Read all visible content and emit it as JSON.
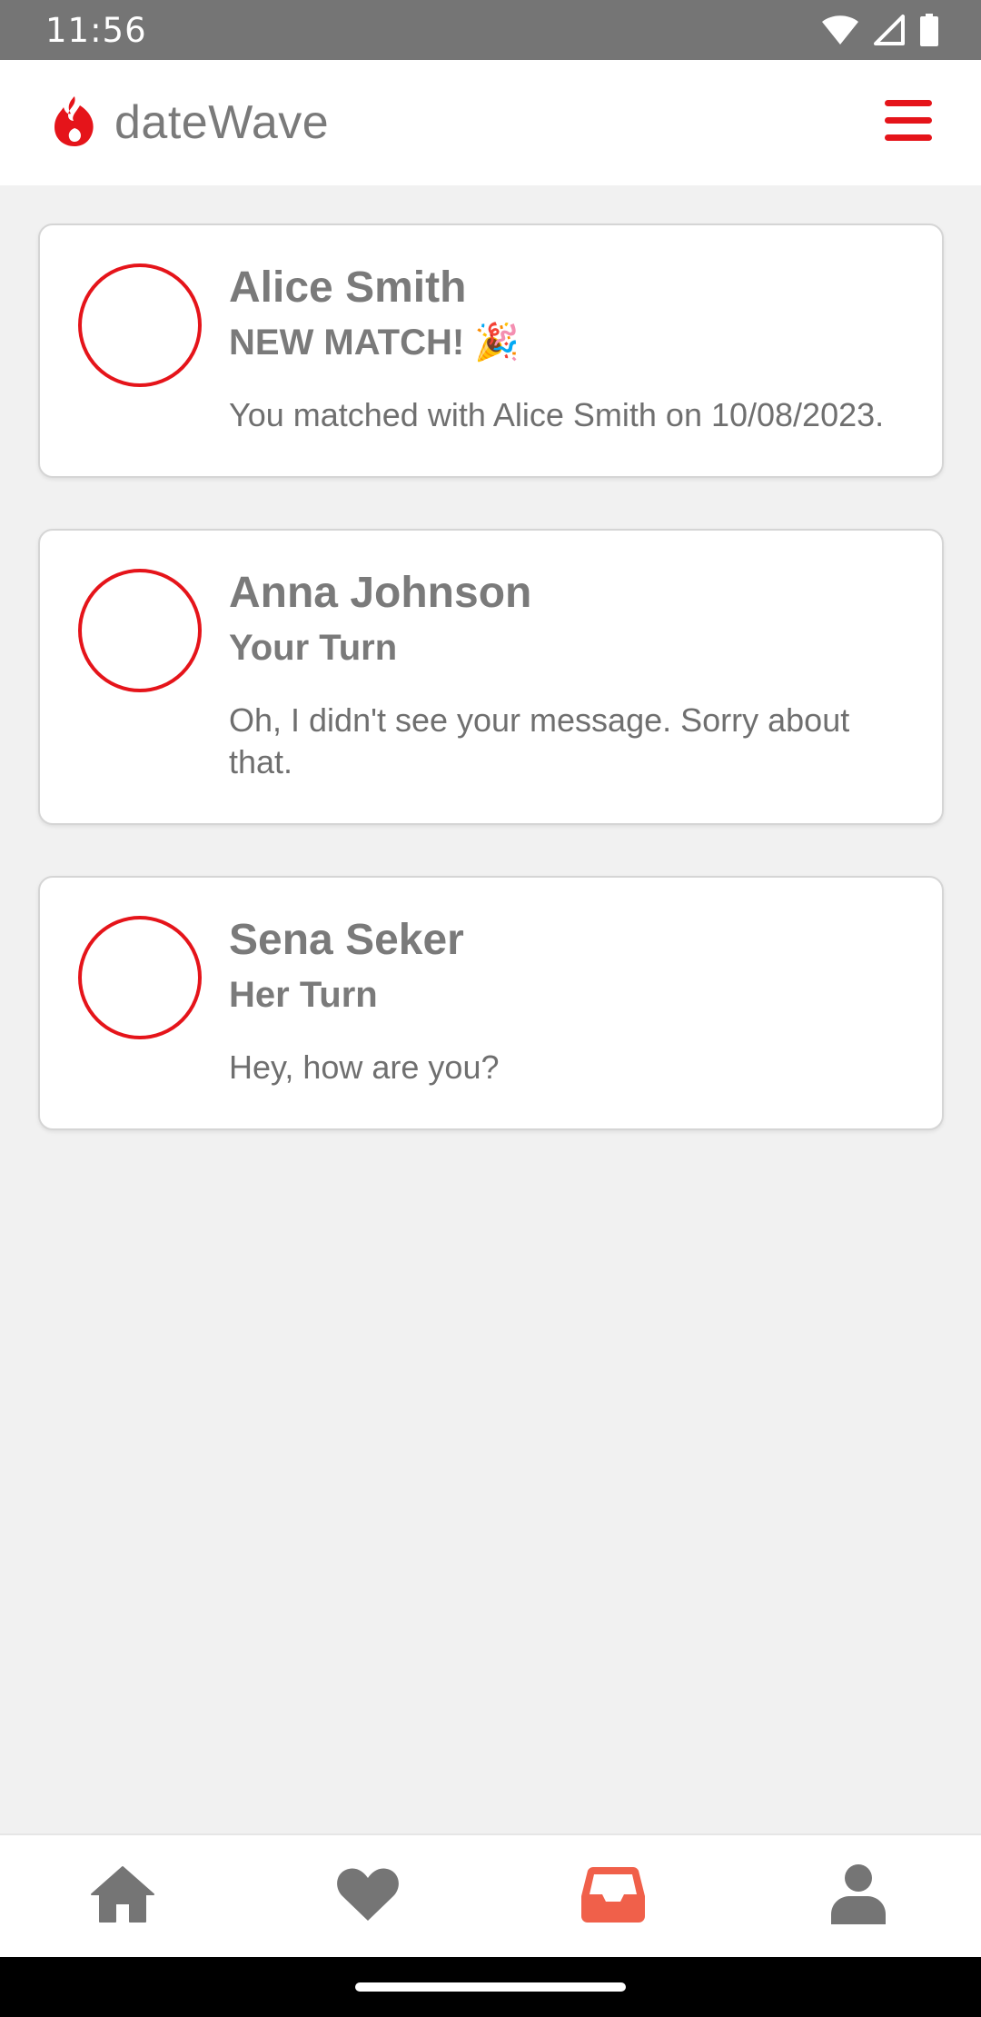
{
  "status_bar": {
    "time": "11:56"
  },
  "header": {
    "app_name": "dateWave"
  },
  "colors": {
    "accent": "#e5141a",
    "active_nav": "#f0604a",
    "text": "#7a7a7a"
  },
  "matches": [
    {
      "name": "Alice Smith",
      "status": "NEW MATCH! 🎉",
      "message": "You matched with Alice Smith on 10/08/2023."
    },
    {
      "name": "Anna Johnson",
      "status": "Your Turn",
      "message": "Oh, I didn't see your message. Sorry about that."
    },
    {
      "name": "Sena Seker",
      "status": "Her Turn",
      "message": "Hey, how are you?"
    }
  ],
  "bottom_nav": {
    "items": [
      {
        "icon": "home-icon",
        "active": false
      },
      {
        "icon": "heart-icon",
        "active": false
      },
      {
        "icon": "inbox-icon",
        "active": true
      },
      {
        "icon": "profile-icon",
        "active": false
      }
    ]
  }
}
